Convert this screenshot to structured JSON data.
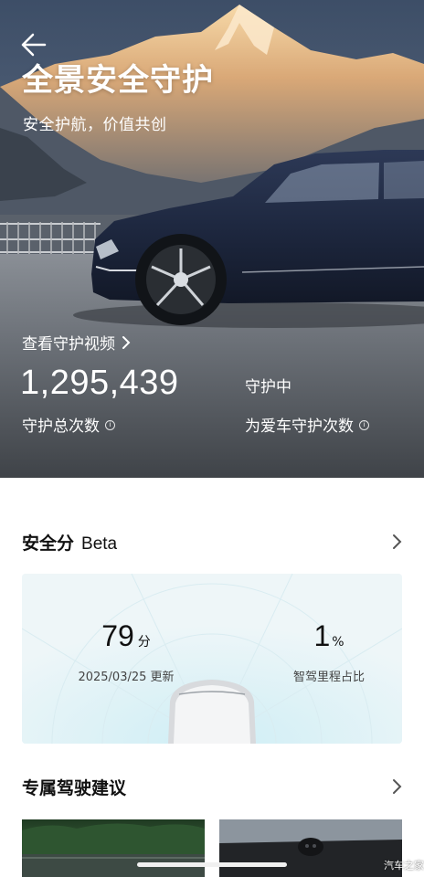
{
  "header": {
    "back_icon": "arrow-left-icon",
    "title": "全景安全守护",
    "subtitle": "安全护航，价值共创"
  },
  "guard": {
    "video_link_label": "查看守护视频",
    "video_link_icon": "chevron-right-icon",
    "total_count": "1,295,439",
    "total_count_label": "守护总次数",
    "status": "守护中",
    "car_count_label": "为爱车守护次数",
    "info_icon": "info-icon"
  },
  "safety_score": {
    "title": "安全分",
    "beta_label": "Beta",
    "score": "79",
    "score_unit": "分",
    "updated": "2025/03/25 更新",
    "smart_drive_ratio": "1",
    "smart_drive_ratio_unit": "%",
    "smart_drive_ratio_label": "智驾里程占比"
  },
  "driving_advice": {
    "title": "专属驾驶建议"
  },
  "watermark": "汽车之家",
  "colors": {
    "card_bg": "#eef6f8",
    "hero_sky": "#3f4f66",
    "car_body": "#1f2a44"
  }
}
